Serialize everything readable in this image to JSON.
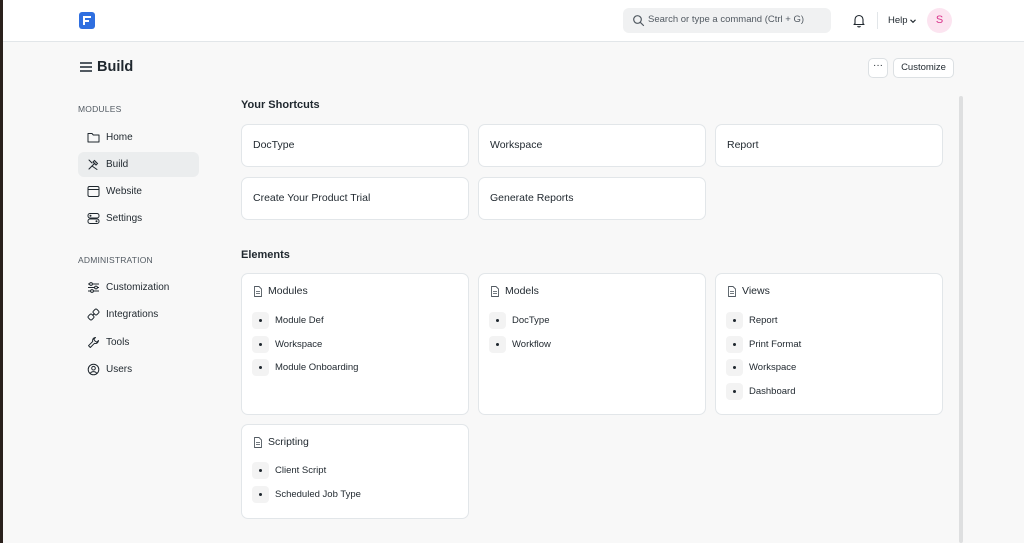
{
  "navbar": {
    "logo_icon": "frappe-logo-icon",
    "search_placeholder": "Search or type a command (Ctrl + G)",
    "help_label": "Help",
    "avatar_initial": "S"
  },
  "page": {
    "title": "Build",
    "more_label": "···",
    "customize_label": "Customize"
  },
  "sidebar": {
    "modules_label": "MODULES",
    "modules": [
      {
        "label": "Home",
        "icon": "folder-icon"
      },
      {
        "label": "Build",
        "icon": "tools-icon",
        "active": true
      },
      {
        "label": "Website",
        "icon": "browser-icon"
      },
      {
        "label": "Settings",
        "icon": "settings-icon"
      }
    ],
    "admin_label": "ADMINISTRATION",
    "admin": [
      {
        "label": "Customization",
        "icon": "sliders-icon"
      },
      {
        "label": "Integrations",
        "icon": "integrations-icon"
      },
      {
        "label": "Tools",
        "icon": "wrench-icon"
      },
      {
        "label": "Users",
        "icon": "users-icon"
      }
    ]
  },
  "shortcuts": {
    "heading": "Your Shortcuts",
    "items": [
      "DocType",
      "Workspace",
      "Report",
      "Create Your Product Trial",
      "Generate Reports"
    ]
  },
  "elements": {
    "heading": "Elements",
    "cards": [
      {
        "title": "Modules",
        "links": [
          "Module Def",
          "Workspace",
          "Module Onboarding"
        ]
      },
      {
        "title": "Models",
        "links": [
          "DocType",
          "Workflow"
        ]
      },
      {
        "title": "Views",
        "links": [
          "Report",
          "Print Format",
          "Workspace",
          "Dashboard"
        ]
      },
      {
        "title": "Scripting",
        "links": [
          "Client Script",
          "Scheduled Job Type"
        ]
      }
    ]
  },
  "colors": {
    "accent": "#2f6fe0",
    "avatar_bg": "#fce4f0",
    "avatar_text": "#d9348b"
  }
}
